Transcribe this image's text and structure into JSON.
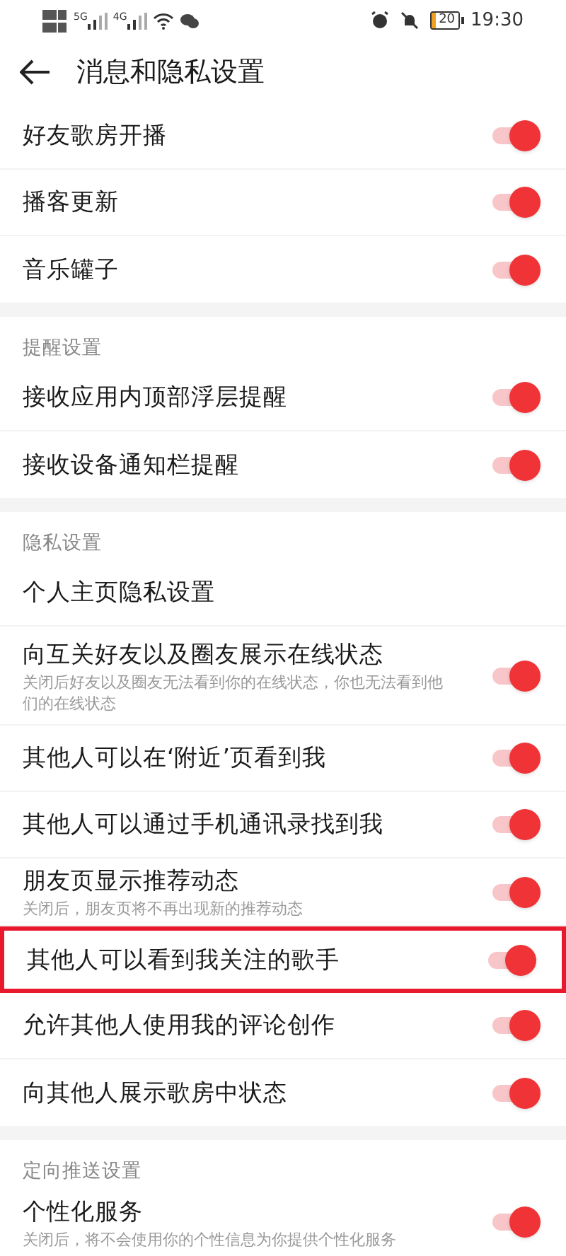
{
  "status_bar": {
    "networks": [
      "5G",
      "4G"
    ],
    "battery": "20",
    "time": "19:30"
  },
  "header": {
    "title": "消息和隐私设置"
  },
  "sections": [
    {
      "rows": [
        {
          "title": "好友歌房开播",
          "kind": "toggle",
          "on": true,
          "highlighted": false
        },
        {
          "title": "播客更新",
          "kind": "toggle",
          "on": true,
          "highlighted": false
        },
        {
          "title": "音乐罐子",
          "kind": "toggle",
          "on": true,
          "highlighted": false
        }
      ]
    },
    {
      "heading": "提醒设置",
      "rows": [
        {
          "title": "接收应用内顶部浮层提醒",
          "kind": "toggle",
          "on": true,
          "highlighted": false
        },
        {
          "title": "接收设备通知栏提醒",
          "kind": "toggle",
          "on": true,
          "highlighted": false
        }
      ]
    },
    {
      "heading": "隐私设置",
      "rows": [
        {
          "title": "个人主页隐私设置",
          "kind": "link",
          "highlighted": false
        },
        {
          "title": "向互关好友以及圈友展示在线状态",
          "subtitle": "关闭后好友以及圈友无法看到你的在线状态，你也无法看到他们的在线状态",
          "kind": "toggle",
          "on": true,
          "highlighted": false
        },
        {
          "title": "其他人可以在‘附近’页看到我",
          "kind": "toggle",
          "on": true,
          "highlighted": false
        },
        {
          "title": "其他人可以通过手机通讯录找到我",
          "kind": "toggle",
          "on": true,
          "highlighted": false
        },
        {
          "title": "朋友页显示推荐动态",
          "subtitle": "关闭后，朋友页将不再出现新的推荐动态",
          "kind": "toggle",
          "on": true,
          "highlighted": false
        },
        {
          "title": "其他人可以看到我关注的歌手",
          "kind": "toggle",
          "on": true,
          "highlighted": true
        },
        {
          "title": "允许其他人使用我的评论创作",
          "kind": "toggle",
          "on": true,
          "highlighted": false
        },
        {
          "title": "向其他人展示歌房中状态",
          "kind": "toggle",
          "on": true,
          "highlighted": false
        }
      ]
    },
    {
      "heading": "定向推送设置",
      "rows": [
        {
          "title": "个性化服务",
          "subtitle": "关闭后，将不会使用你的个性信息为你提供个性化服务",
          "kind": "toggle",
          "on": true,
          "highlighted": false
        }
      ]
    }
  ]
}
